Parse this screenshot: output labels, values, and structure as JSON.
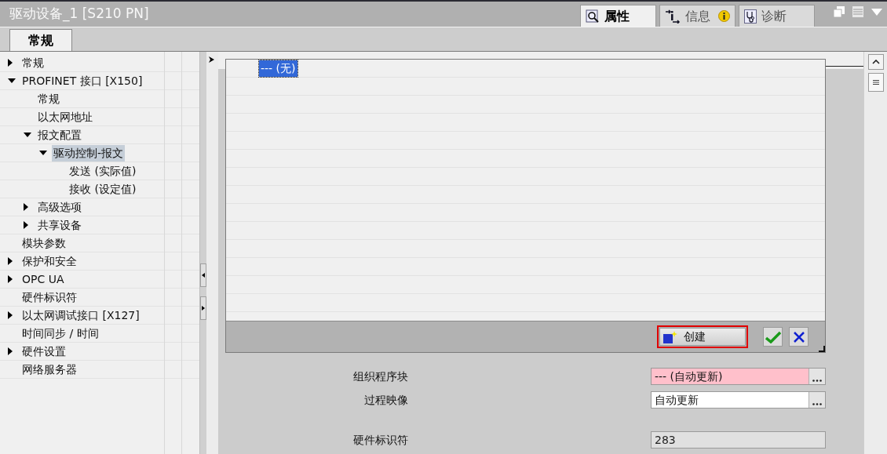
{
  "title": "驱动设备_1 [S210 PN]",
  "inspector_tabs": [
    {
      "label": "属性",
      "kind": "properties",
      "selected": true
    },
    {
      "label": "信息",
      "kind": "info",
      "selected": false
    },
    {
      "label": "诊断",
      "kind": "diagnostics",
      "selected": false
    }
  ],
  "section_tabs": [
    {
      "label": "常规",
      "selected": true
    }
  ],
  "tree": [
    {
      "label": "常规",
      "kind": "folder",
      "expanded": false,
      "selected": false
    },
    {
      "label": "PROFINET 接口 [X150]",
      "kind": "folder",
      "expanded": true,
      "selected": false,
      "children": [
        {
          "label": "常规",
          "kind": "leaf",
          "selected": false
        },
        {
          "label": "以太网地址",
          "kind": "leaf",
          "selected": false
        },
        {
          "label": "报文配置",
          "kind": "folder",
          "expanded": true,
          "selected": false,
          "children": [
            {
              "label": "驱动控制-报文",
              "kind": "folder",
              "expanded": true,
              "selected": true,
              "children": [
                {
                  "label": "发送 (实际值)",
                  "kind": "leaf",
                  "selected": false
                },
                {
                  "label": "接收 (设定值)",
                  "kind": "leaf",
                  "selected": false
                }
              ]
            }
          ]
        },
        {
          "label": "高级选项",
          "kind": "folder",
          "expanded": false,
          "selected": false
        },
        {
          "label": "共享设备",
          "kind": "folder",
          "expanded": false,
          "selected": false
        }
      ]
    },
    {
      "label": "模块参数",
      "kind": "leaf",
      "selected": false
    },
    {
      "label": "保护和安全",
      "kind": "folder",
      "expanded": false,
      "selected": false
    },
    {
      "label": "OPC UA",
      "kind": "folder",
      "expanded": false,
      "selected": false
    },
    {
      "label": "硬件标识符",
      "kind": "leaf",
      "selected": false
    },
    {
      "label": "以太网调试接口 [X127]",
      "kind": "folder",
      "expanded": false,
      "selected": false
    },
    {
      "label": "时间同步 / 时间",
      "kind": "leaf",
      "selected": false
    },
    {
      "label": "硬件设置",
      "kind": "folder",
      "expanded": false,
      "selected": false
    },
    {
      "label": "网络服务器",
      "kind": "leaf",
      "selected": false
    }
  ],
  "dropdown": {
    "items": [
      {
        "label": "--- (无)",
        "selected": true
      }
    ],
    "create_button": "创建"
  },
  "fields": [
    {
      "label": "组织程序块",
      "value": "--- (自动更新)",
      "kind": "browse",
      "invalid": true
    },
    {
      "label": "过程映像",
      "value": "自动更新",
      "kind": "browse",
      "invalid": false
    },
    {
      "label": "硬件标识符",
      "value": "283",
      "kind": "readonly"
    }
  ]
}
